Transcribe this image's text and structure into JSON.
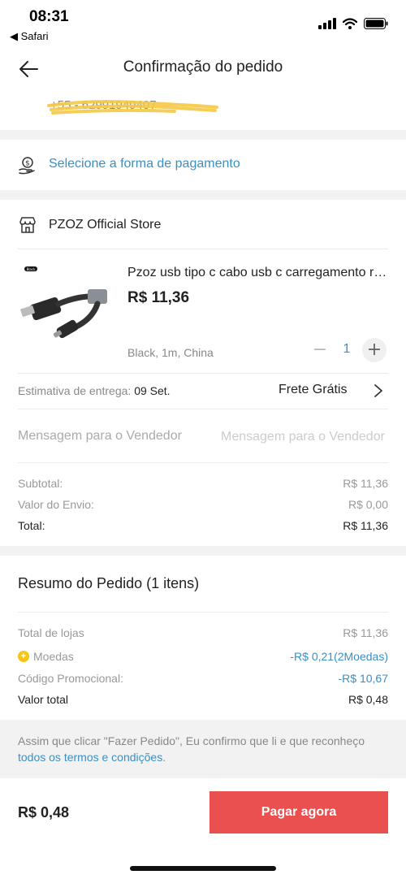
{
  "status_bar": {
    "time": "08:31",
    "back_app": "◀ Safari"
  },
  "header": {
    "title": "Confirmação do pedido"
  },
  "address": {
    "phone": "+55 - 62991949407"
  },
  "payment": {
    "label": "Selecione a forma de pagamento"
  },
  "store": {
    "name": "PZOZ Official Store"
  },
  "product": {
    "title": "Pzoz usb tipo c cabo usb c carregamento rápido",
    "price": "R$ 11,36",
    "variant": "Black, 1m, China",
    "quantity": "1",
    "minus": "−",
    "plus": "+",
    "image_tag": "Black"
  },
  "delivery": {
    "label": "Estimativa de entrega: ",
    "date": "09 Set.",
    "shipping": "Frete Grátis"
  },
  "message": {
    "label": "Mensagem para o Vendedor",
    "placeholder": "Mensagem para o Vendedor"
  },
  "store_totals": [
    {
      "label": "Subtotal:",
      "value": "R$ 11,36"
    },
    {
      "label": "Valor do Envio:",
      "value": "R$ 0,00"
    },
    {
      "label": "Total:",
      "value": "R$ 11,36"
    }
  ],
  "summary": {
    "title": "Resumo do Pedido (1 itens)",
    "rows": [
      {
        "label": "Total de lojas",
        "value": "R$ 11,36"
      },
      {
        "label": "Moedas",
        "value": "-R$ 0,21(2Moedas)"
      },
      {
        "label": "Código Promocional:",
        "value": "-R$ 10,67"
      },
      {
        "label": "Valor total",
        "value": "R$ 0,48"
      }
    ]
  },
  "terms": {
    "text": "Assim que clicar \"Fazer Pedido\", Eu confirmo que li e que reconheço ",
    "link": "todos os termos e condições",
    "end": "."
  },
  "footer": {
    "total": "R$ 0,48",
    "button": "Pagar agora"
  },
  "colors": {
    "accent_blue": "#3a8fc4",
    "pay_button": "#eb5050",
    "coin": "#f5c518",
    "scribble": "#f5c842"
  }
}
